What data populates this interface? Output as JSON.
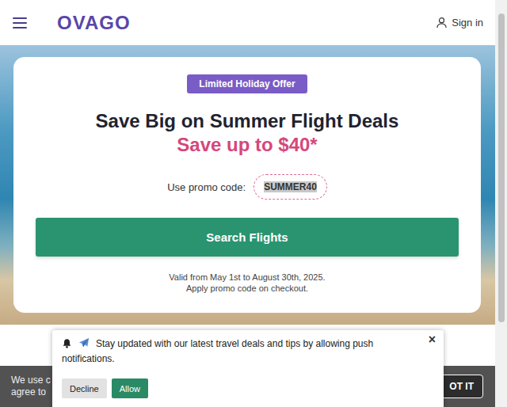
{
  "header": {
    "logo": "OVAGO",
    "sign_in": "Sign in"
  },
  "promo": {
    "badge": "Limited Holiday Offer",
    "title": "Save Big on Summer Flight Deals",
    "subtitle": "Save up to $40*",
    "code_label": "Use promo code:",
    "code": "SUMMER40",
    "code_selected": true,
    "button": "Search Flights",
    "validity": [
      "Valid from May 1st to August 30th, 2025.",
      "Apply promo code on checkout."
    ]
  },
  "cookie_bar": {
    "lines": [
      "We use c",
      "agree to"
    ],
    "button": "OT IT"
  },
  "notification": {
    "message": "Stay updated with our latest travel deals and tips by allowing push notifications.",
    "close": "×",
    "buttons": [
      {
        "label": "Decline",
        "primary": false
      },
      {
        "label": "Allow",
        "primary": true
      }
    ]
  }
}
